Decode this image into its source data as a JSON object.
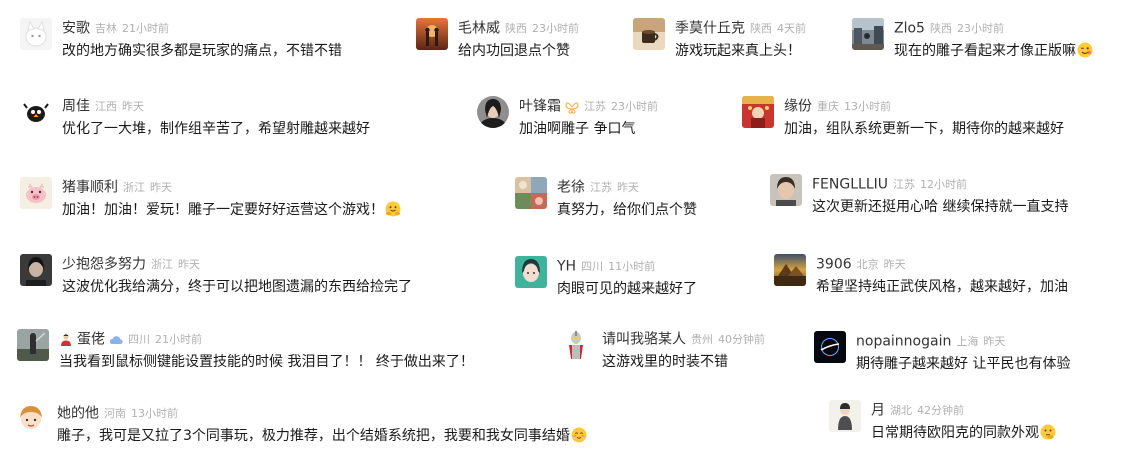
{
  "comments": [
    {
      "name": "安歌",
      "location": "吉林",
      "time": "21小时前",
      "text": "改的地方确实很多都是玩家的痛点，不错不错",
      "avatar": "white-cat-avatar"
    },
    {
      "name": "毛林威",
      "location": "陕西",
      "time": "23小时前",
      "text": "给内功回退点个赞",
      "avatar": "sunset-couple-avatar"
    },
    {
      "name": "季莫什丘克",
      "location": "陕西",
      "time": "4天前",
      "text": "游戏玩起来真上头！",
      "avatar": "coffee-cup-avatar"
    },
    {
      "name": "Zlo5",
      "location": "陕西",
      "time": "23小时前",
      "text": "现在的雕子看起来才像正版嘛",
      "emoji": "wink-face-emoji",
      "avatar": "street-avatar"
    },
    {
      "name": "周佳",
      "location": "江西",
      "time": "昨天",
      "text": "优化了一大堆，制作组辛苦了，希望射雕越来越好",
      "avatar": "cartoon-bird-avatar"
    },
    {
      "name": "叶锋霜",
      "location": "江苏",
      "time": "23小时前",
      "text": "加油啊雕子 争口气",
      "badge": "butterfly-badge-icon",
      "avatar": "portrait-avatar"
    },
    {
      "name": "缘份",
      "location": "重庆",
      "time": "13小时前",
      "text": "加油，组队系统更新一下，期待你的越来越好",
      "avatar": "red-festival-avatar"
    },
    {
      "name": "猪事顺利",
      "location": "浙江",
      "time": "昨天",
      "text": "加油！加油！爱玩！雕子一定要好好运营这个游戏！",
      "emoji": "hug-face-emoji",
      "avatar": "piggy-avatar"
    },
    {
      "name": "老徐",
      "location": "江苏",
      "time": "昨天",
      "text": "真努力，给你们点个赞",
      "avatar": "collage-avatar"
    },
    {
      "name": "FENGLLLIU",
      "location": "江苏",
      "time": "12小时前",
      "text": "这次更新还挺用心哈 继续保持就一直支持",
      "avatar": "boy-portrait-avatar"
    },
    {
      "name": "少抱怨多努力",
      "location": "浙江",
      "time": "昨天",
      "text": "这波优化我给满分，终于可以把地图遗漏的东西给捡完了",
      "avatar": "dark-portrait-avatar"
    },
    {
      "name": "YH",
      "location": "四川",
      "time": "11小时前",
      "text": "肉眼可见的越来越好了",
      "avatar": "teal-anime-avatar"
    },
    {
      "name": "3906",
      "location": "北京",
      "time": "昨天",
      "text": "希望坚持纯正武侠风格，越来越好，加油",
      "avatar": "golden-landscape-avatar"
    },
    {
      "name": "蛋佬",
      "location": "四川",
      "time": "21小时前",
      "text": "当我看到鼠标侧键能设置技能的时候 我泪目了！！ 终于做出来了！",
      "prefix_icon": "figure-prefix-icon",
      "badge": "cloud-badge-icon",
      "avatar": "warrior-avatar"
    },
    {
      "name": "请叫我骆某人",
      "location": "贵州",
      "time": "40分钟前",
      "text": "这游戏里的时装不错",
      "avatar": "ultraman-avatar"
    },
    {
      "name": "nopainnogain",
      "location": "上海",
      "time": "昨天",
      "text": "期待雕子越来越好 让平民也有体验",
      "avatar": "eclipse-avatar"
    },
    {
      "name": "她的他",
      "location": "河南",
      "time": "13小时前",
      "text": "雕子，我可是又拉了3个同事玩，极力推荐，出个结婚系统把，我要和我女同事结婚",
      "emoji": "shy-face-emoji",
      "avatar": "cartoon-girl-avatar"
    },
    {
      "name": "月",
      "location": "湖北",
      "time": "42分钟前",
      "text": "日常期待欧阳克的同款外观",
      "emoji": "thinking-face-emoji",
      "avatar": "small-figure-avatar"
    }
  ]
}
